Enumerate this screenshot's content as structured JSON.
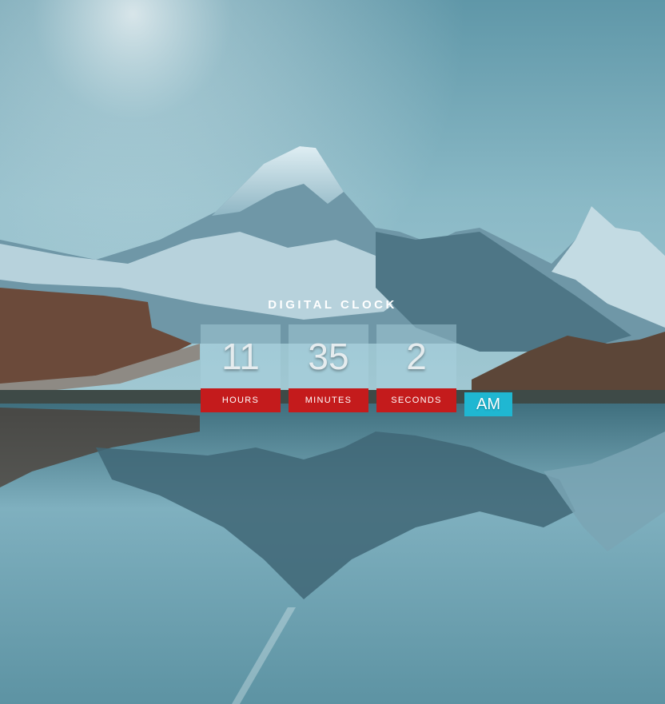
{
  "clock": {
    "title": "DIGITAL CLOCK",
    "hours": {
      "value": "11",
      "label": "HOURS"
    },
    "minutes": {
      "value": "35",
      "label": "MINUTES"
    },
    "seconds": {
      "value": "2",
      "label": "SECONDS"
    },
    "meridiem": "AM"
  },
  "colors": {
    "label_bg": "#c41b1c",
    "meridiem_bg": "#1fb7d2",
    "value_bg": "rgba(170,210,225,0.45)"
  }
}
